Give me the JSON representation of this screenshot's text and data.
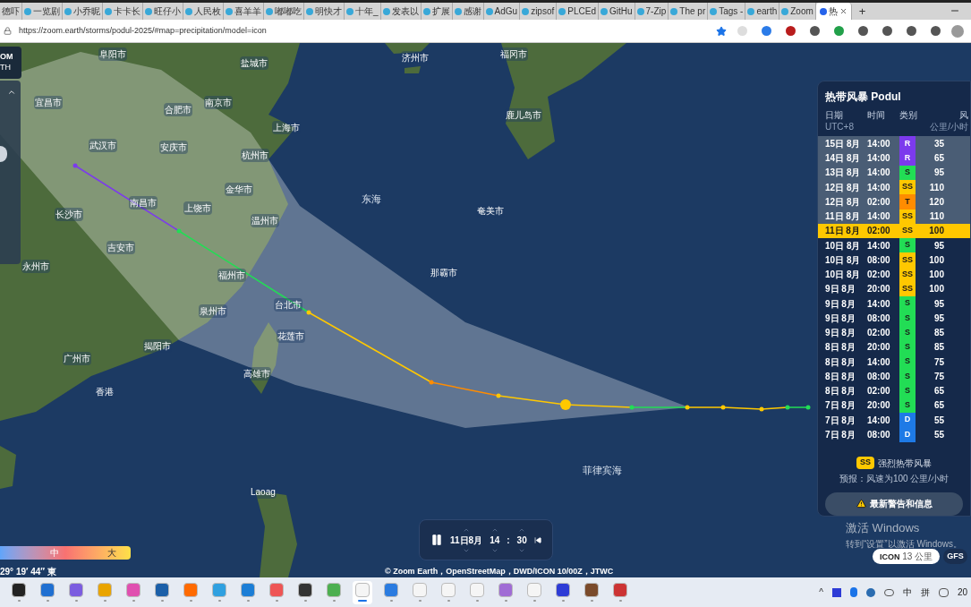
{
  "browser": {
    "tabs": [
      {
        "label": "德吓",
        "selected": false
      },
      {
        "label": "一览剧",
        "selected": false
      },
      {
        "label": "小乔昵",
        "selected": false
      },
      {
        "label": "卡卡长",
        "selected": false
      },
      {
        "label": "旺仔小",
        "selected": false
      },
      {
        "label": "人民枚",
        "selected": false
      },
      {
        "label": "喜羊羊",
        "selected": false
      },
      {
        "label": "嘟嘟吃",
        "selected": false
      },
      {
        "label": "明快才",
        "selected": false
      },
      {
        "label": "十年_",
        "selected": false
      },
      {
        "label": "发表以",
        "selected": false
      },
      {
        "label": "扩展",
        "selected": false
      },
      {
        "label": "感谢",
        "selected": false
      },
      {
        "label": "AdGu",
        "selected": false
      },
      {
        "label": "zipsof",
        "selected": false
      },
      {
        "label": "PLCEd",
        "selected": false
      },
      {
        "label": "GitHu",
        "selected": false
      },
      {
        "label": "7-Zip",
        "selected": false
      },
      {
        "label": "The pr",
        "selected": false
      },
      {
        "label": "Tags -",
        "selected": false
      },
      {
        "label": "earth",
        "selected": false
      },
      {
        "label": "Zoom",
        "selected": false
      },
      {
        "label": "热",
        "selected": true
      }
    ],
    "new_tab": "+",
    "url": "https://zoom.earth/storms/podul-2025/#map=precipitation/model=icon"
  },
  "logo": [
    "OM",
    "TH"
  ],
  "map": {
    "labels": [
      {
        "text": "阜阳市",
        "kind": "city"
      },
      {
        "text": "盐城市",
        "kind": "city"
      },
      {
        "text": "济州市",
        "kind": "city"
      },
      {
        "text": "福冈市",
        "kind": "city"
      },
      {
        "text": "宜昌市",
        "kind": "city"
      },
      {
        "text": "合肥市",
        "kind": "city"
      },
      {
        "text": "南京市",
        "kind": "city"
      },
      {
        "text": "鹿儿岛市",
        "kind": "city"
      },
      {
        "text": "上海市",
        "kind": "city"
      },
      {
        "text": "杭州市",
        "kind": "city"
      },
      {
        "text": "武汉市",
        "kind": "city"
      },
      {
        "text": "安庆市",
        "kind": "city"
      },
      {
        "text": "金华市",
        "kind": "city"
      },
      {
        "text": "东海",
        "kind": "sea"
      },
      {
        "text": "奄美市",
        "kind": "city"
      },
      {
        "text": "长沙市",
        "kind": "city"
      },
      {
        "text": "南昌市",
        "kind": "city"
      },
      {
        "text": "上饶市",
        "kind": "city"
      },
      {
        "text": "温州市",
        "kind": "city"
      },
      {
        "text": "吉安市",
        "kind": "city"
      },
      {
        "text": "永州市",
        "kind": "city"
      },
      {
        "text": "福州市",
        "kind": "city"
      },
      {
        "text": "那霸市",
        "kind": "city"
      },
      {
        "text": "台北市",
        "kind": "city"
      },
      {
        "text": "泉州市",
        "kind": "city"
      },
      {
        "text": "花莲市",
        "kind": "city"
      },
      {
        "text": "揭阳市",
        "kind": "city"
      },
      {
        "text": "广州市",
        "kind": "city"
      },
      {
        "text": "高雄市",
        "kind": "city"
      },
      {
        "text": "香港",
        "kind": "city"
      },
      {
        "text": "菲律宾海",
        "kind": "sea"
      },
      {
        "text": "Laoag",
        "kind": "city"
      }
    ],
    "legend": [
      "中",
      "大"
    ],
    "coordinates": "29° 19′ 44″ 東",
    "attribution": "© Zoom Earth，OpenStreetMap，DWD/ICON 10/00Z，JTWC"
  },
  "playback": {
    "playing": true,
    "date": "11日8月",
    "hour": "14",
    "separator": ":",
    "minute": "30"
  },
  "storm": {
    "title": "热带风暴 Podul",
    "columns": [
      {
        "label": "日期",
        "sublabel": "UTC+8"
      },
      {
        "label": "时间"
      },
      {
        "label": "类别"
      },
      {
        "label": "风",
        "sublabel": "公里/小时"
      }
    ],
    "rows": [
      {
        "date": "15日 8月",
        "time": "14:00",
        "category": "R",
        "color": "#7c3aed",
        "wind": "35",
        "forecast": true,
        "selected": false
      },
      {
        "date": "14日 8月",
        "time": "14:00",
        "category": "R",
        "color": "#7c3aed",
        "wind": "65",
        "forecast": true,
        "selected": false
      },
      {
        "date": "13日 8月",
        "time": "14:00",
        "category": "S",
        "color": "#22dd55",
        "wind": "95",
        "forecast": true,
        "selected": false
      },
      {
        "date": "12日 8月",
        "time": "14:00",
        "category": "SS",
        "color": "#ffc800",
        "wind": "110",
        "forecast": true,
        "selected": false
      },
      {
        "date": "12日 8月",
        "time": "02:00",
        "category": "T",
        "color": "#ff8c00",
        "wind": "120",
        "forecast": true,
        "selected": false
      },
      {
        "date": "11日 8月",
        "time": "14:00",
        "category": "SS",
        "color": "#ffc800",
        "wind": "110",
        "forecast": true,
        "selected": false
      },
      {
        "date": "11日 8月",
        "time": "02:00",
        "category": "SS",
        "color": "#ffc800",
        "wind": "100",
        "forecast": false,
        "selected": true
      },
      {
        "date": "10日 8月",
        "time": "14:00",
        "category": "S",
        "color": "#22dd55",
        "wind": "95",
        "forecast": false,
        "selected": false
      },
      {
        "date": "10日 8月",
        "time": "08:00",
        "category": "SS",
        "color": "#ffc800",
        "wind": "100",
        "forecast": false,
        "selected": false
      },
      {
        "date": "10日 8月",
        "time": "02:00",
        "category": "SS",
        "color": "#ffc800",
        "wind": "100",
        "forecast": false,
        "selected": false
      },
      {
        "date": "9日 8月",
        "time": "20:00",
        "category": "SS",
        "color": "#ffc800",
        "wind": "100",
        "forecast": false,
        "selected": false
      },
      {
        "date": "9日 8月",
        "time": "14:00",
        "category": "S",
        "color": "#22dd55",
        "wind": "95",
        "forecast": false,
        "selected": false
      },
      {
        "date": "9日 8月",
        "time": "08:00",
        "category": "S",
        "color": "#22dd55",
        "wind": "95",
        "forecast": false,
        "selected": false
      },
      {
        "date": "9日 8月",
        "time": "02:00",
        "category": "S",
        "color": "#22dd55",
        "wind": "85",
        "forecast": false,
        "selected": false
      },
      {
        "date": "8日 8月",
        "time": "20:00",
        "category": "S",
        "color": "#22dd55",
        "wind": "85",
        "forecast": false,
        "selected": false
      },
      {
        "date": "8日 8月",
        "time": "14:00",
        "category": "S",
        "color": "#22dd55",
        "wind": "75",
        "forecast": false,
        "selected": false
      },
      {
        "date": "8日 8月",
        "time": "08:00",
        "category": "S",
        "color": "#22dd55",
        "wind": "75",
        "forecast": false,
        "selected": false
      },
      {
        "date": "8日 8月",
        "time": "02:00",
        "category": "S",
        "color": "#22dd55",
        "wind": "65",
        "forecast": false,
        "selected": false
      },
      {
        "date": "7日 8月",
        "time": "20:00",
        "category": "S",
        "color": "#22dd55",
        "wind": "65",
        "forecast": false,
        "selected": false
      },
      {
        "date": "7日 8月",
        "time": "14:00",
        "category": "D",
        "color": "#1e7ae6",
        "wind": "55",
        "forecast": false,
        "selected": false
      },
      {
        "date": "7日 8月",
        "time": "08:00",
        "category": "D",
        "color": "#1e7ae6",
        "wind": "55",
        "forecast": false,
        "selected": false
      }
    ],
    "current": {
      "category": "SS",
      "color": "#ffc800",
      "name": "强烈热带风暴"
    },
    "forecast_text": "预报：风速为100 公里/小时",
    "button": "最新警告和信息"
  },
  "activation": {
    "title": "激活 Windows",
    "subtitle": "转到“设置”以激活 Windows。"
  },
  "models": [
    {
      "name": "ICON",
      "detail": "13 公里",
      "selected": true
    },
    {
      "name": "GFS",
      "selected": false
    }
  ],
  "taskbar": {
    "apps": [
      {
        "selected": false
      },
      {
        "selected": false
      },
      {
        "selected": false
      },
      {
        "selected": false
      },
      {
        "selected": false
      },
      {
        "selected": false
      },
      {
        "selected": false
      },
      {
        "selected": false
      },
      {
        "selected": false
      },
      {
        "selected": false
      },
      {
        "selected": false
      },
      {
        "selected": false
      },
      {
        "selected": true
      },
      {
        "selected": false
      },
      {
        "selected": false
      },
      {
        "selected": false
      },
      {
        "selected": false
      },
      {
        "selected": false
      },
      {
        "selected": false
      },
      {
        "selected": false
      },
      {
        "selected": false
      },
      {
        "selected": false
      }
    ],
    "tray_chevron": "^",
    "ime": [
      "中",
      "拼"
    ],
    "clock": "20"
  }
}
